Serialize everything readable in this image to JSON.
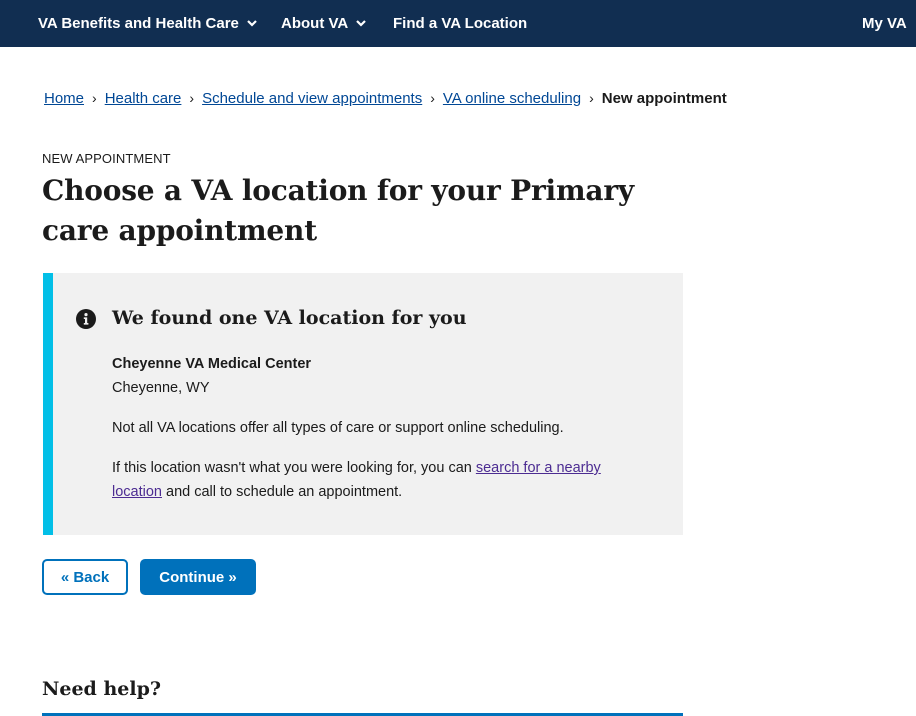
{
  "nav": {
    "benefits": "VA Benefits and Health Care",
    "about": "About VA",
    "find_location": "Find a VA Location",
    "my_va": "My VA"
  },
  "breadcrumb": {
    "home": "Home",
    "health_care": "Health care",
    "schedule": "Schedule and view appointments",
    "online_scheduling": "VA online scheduling",
    "current": "New appointment",
    "separator": "›"
  },
  "page": {
    "eyebrow": "New appointment",
    "title": "Choose a VA location for your Primary care appointment"
  },
  "alert": {
    "heading": "We found one VA location for you",
    "facility_name": "Cheyenne VA Medical Center",
    "facility_city": "Cheyenne, WY",
    "note": "Not all VA locations offer all types of care or support online scheduling.",
    "search_prefix": "If this location wasn't what you were looking for, you can ",
    "search_link": "search for a nearby location",
    "search_suffix": " and call to schedule an appointment."
  },
  "buttons": {
    "back": "« Back",
    "continue": "Continue »"
  },
  "help": {
    "heading": "Need help?"
  },
  "colors": {
    "nav_background": "#112e51",
    "primary": "#0071bb",
    "link": "#004795",
    "visited_link": "#4c2c92",
    "alert_border": "#02bfe7",
    "alert_background": "#f1f1f1"
  }
}
